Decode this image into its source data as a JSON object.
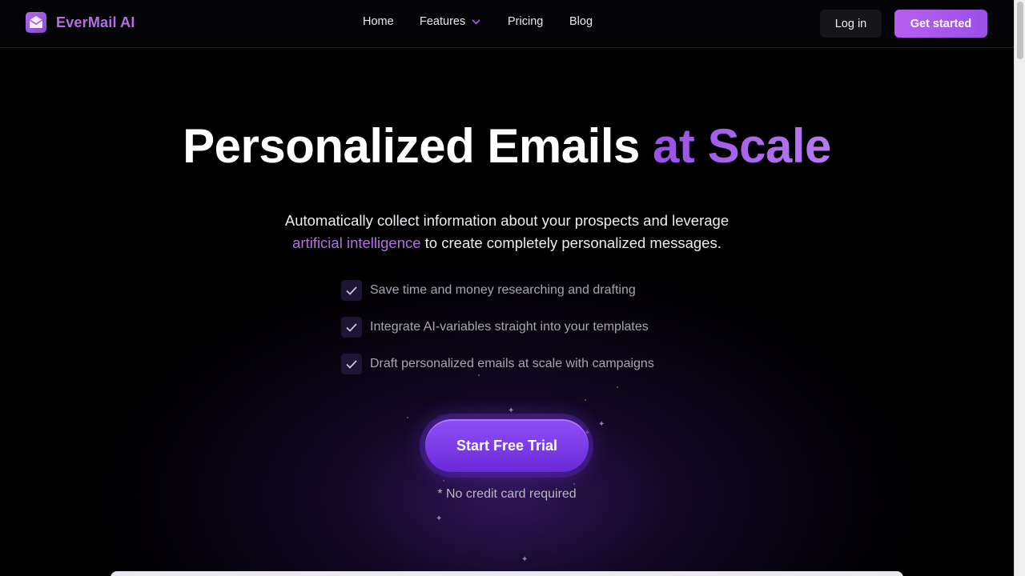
{
  "header": {
    "brand": "EverMail AI",
    "nav": {
      "home": "Home",
      "features": "Features",
      "pricing": "Pricing",
      "blog": "Blog"
    },
    "login": "Log in",
    "get_started": "Get started"
  },
  "hero": {
    "title_main": "Personalized Emails ",
    "title_accent": "at Scale",
    "subtitle_line1": "Automatically collect information about your prospects and leverage",
    "subtitle_link": "artificial intelligence",
    "subtitle_line2_rest": " to create completely personalized messages.",
    "features": [
      "Save time and money researching and drafting",
      "Integrate AI-variables straight into your templates",
      "Draft personalized emails at scale with campaigns"
    ],
    "cta": "Start Free Trial",
    "note": "* No credit card required"
  },
  "colors": {
    "brand_purple": "#b56ee8",
    "cta_purple": "#7a3af0",
    "background": "#000000"
  },
  "icons": {
    "logo": "envelope-icon",
    "features_dropdown": "chevron-down-icon",
    "feature_check": "check-icon",
    "sparkle": "sparkle-icon"
  }
}
